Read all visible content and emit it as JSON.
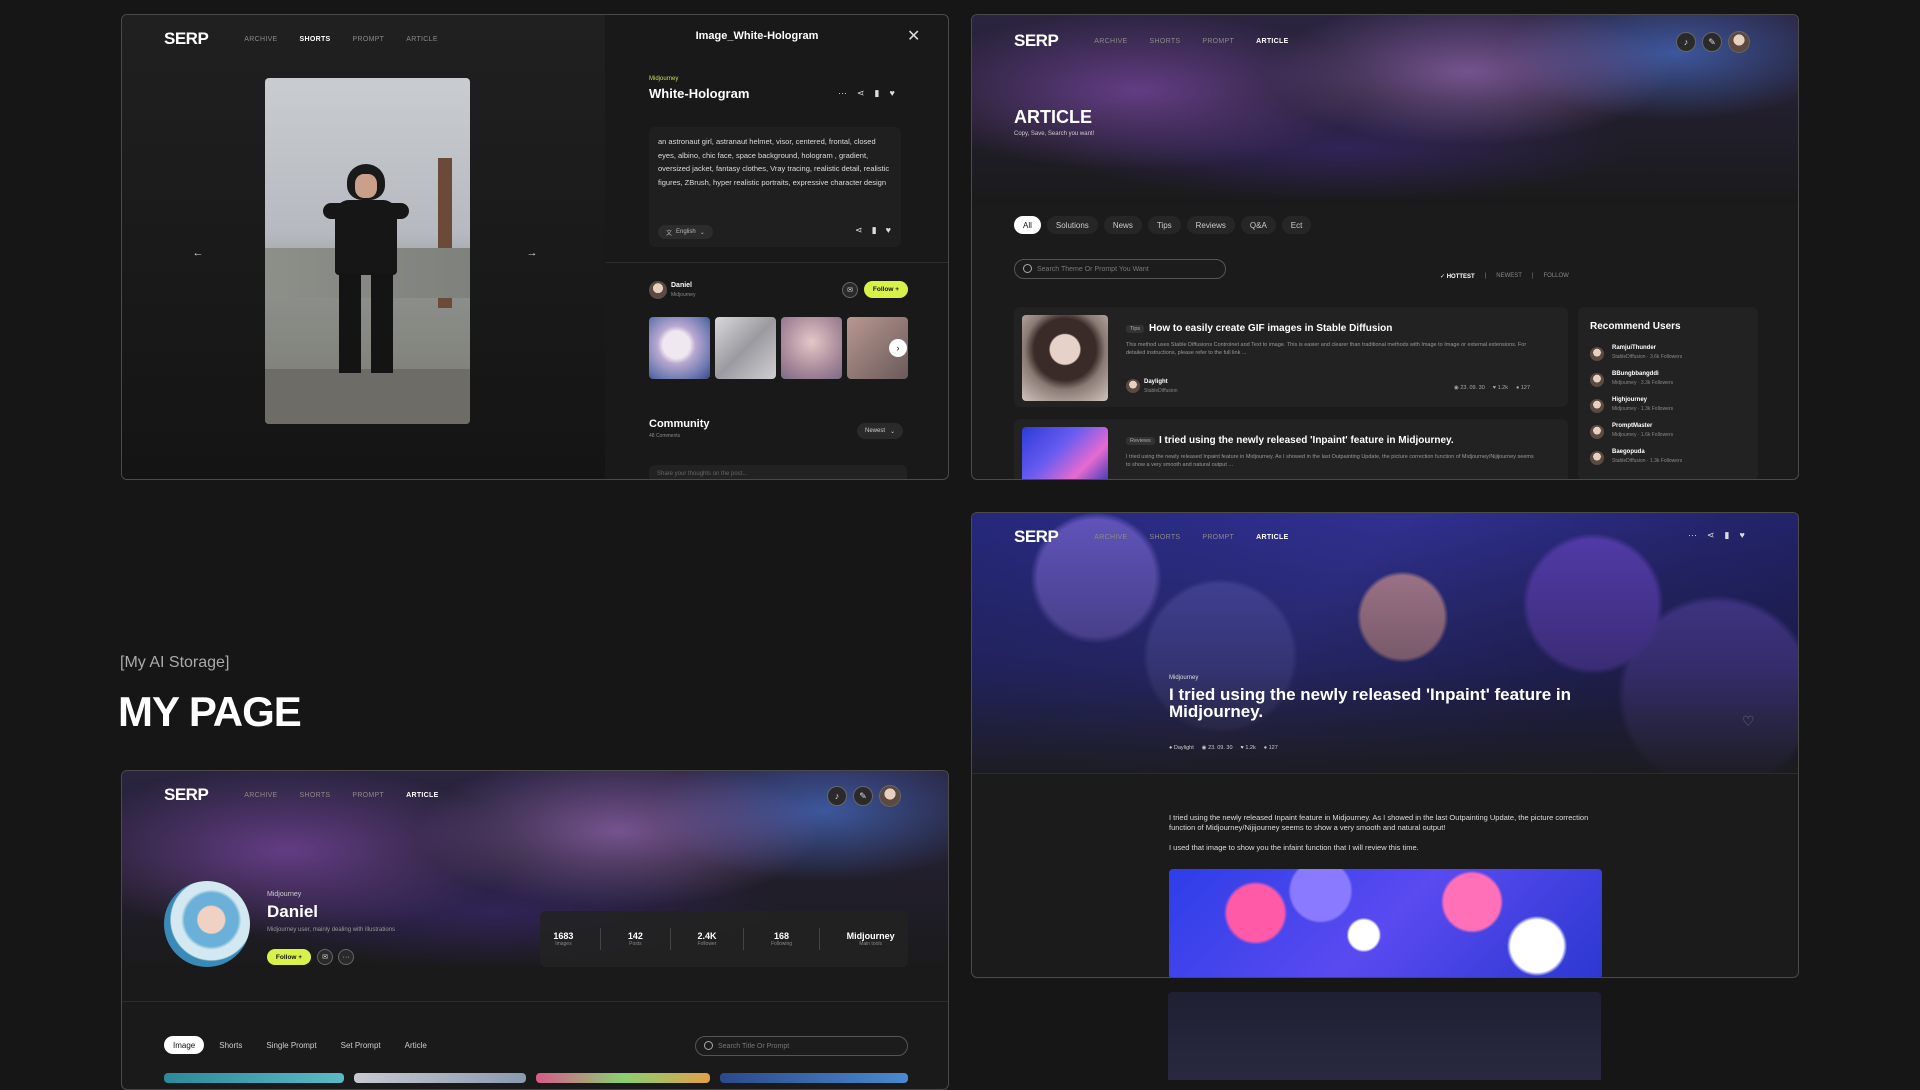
{
  "nav": {
    "logo": "SERP",
    "archive": "ARCHIVE",
    "shorts": "SHORTS",
    "prompt": "PROMPT",
    "article": "ARTICLE"
  },
  "detail": {
    "title": "Image_White-Hologram",
    "source": "Midjourney",
    "name": "White-Hologram",
    "prompt": "an astronaut girl, astranaut helmet, visor, centered, frontal, closed eyes, albino, chic face, space background, hologram , gradient, oversized jacket, fantasy clothes, Vray tracing, realistic detail, realistic figures, ZBrush, hyper realistic portraits, expressive character design",
    "language": "English",
    "author_name": "Daniel",
    "author_sub": "Midjourney",
    "follow": "Follow +",
    "community": "Community",
    "comments": "48 Comments",
    "sort": "Newest",
    "comment_placeholder": "Share your thoughts on the post..."
  },
  "article_list": {
    "heading": "ARTICLE",
    "sub": "Copy, Save, Search you want!",
    "tabs": [
      "All",
      "Solutions",
      "News",
      "Tips",
      "Reviews",
      "Q&A",
      "Ect"
    ],
    "search_placeholder": "Search Theme Or Prompt You Want",
    "sort": [
      "HOTTEST",
      "NEWEST",
      "FOLLOW"
    ],
    "posts": [
      {
        "tag": "Tips",
        "title": "How to easily create GIF images in Stable Diffusion",
        "body": "This method uses Stable Diffusions Controlnet and Text to image. This is easier and clearer than traditional methods with Image to Image or external extensions. For detailed instructions, please refer to the full link ...",
        "author": "Daylight",
        "author_sub": "StableDiffusion",
        "date": "23. 09. 30",
        "likes": "1.2k",
        "comments": "127"
      },
      {
        "tag": "Reviews",
        "title": "I tried using the newly released 'Inpaint' feature in Midjourney.",
        "body": "I tried using the newly released Inpaint feature in Midjourney. As I showed in the last Outpainting Update, the picture correction function of Midjourney/Nijijourney seems to show a very smooth and natural output ..."
      }
    ],
    "recommend_title": "Recommend Users",
    "users": [
      {
        "name": "RamjuiThunder",
        "sub": "StableDiffusion · 3.6k Followers"
      },
      {
        "name": "BBungbbangddi",
        "sub": "Midjourney · 3.3k Followers"
      },
      {
        "name": "Highjourney",
        "sub": "Midjourney · 1.3k Followers"
      },
      {
        "name": "PromptMaster",
        "sub": "Midjourney · 1.6k Followers"
      },
      {
        "name": "Baegopuda",
        "sub": "StableDiffusion · 1.3k Followers"
      }
    ]
  },
  "section": {
    "label": "[My AI Storage]",
    "title": "MY PAGE"
  },
  "mypage": {
    "source": "Midjourney",
    "name": "Daniel",
    "bio": "Midjourney user, mainly dealing with illustrations",
    "follow": "Follow +",
    "stats": [
      {
        "value": "1683",
        "label": "Images"
      },
      {
        "value": "142",
        "label": "Posts"
      },
      {
        "value": "2.4K",
        "label": "Follower"
      },
      {
        "value": "168",
        "label": "Following"
      },
      {
        "value": "Midjourney",
        "label": "Main tools"
      }
    ],
    "tabs": [
      "Image",
      "Shorts",
      "Single Prompt",
      "Set Prompt",
      "Article"
    ],
    "search_placeholder": "Search Title Or Prompt"
  },
  "article_detail": {
    "source": "Midjourney",
    "title": "I tried using the newly released 'Inpaint' feature in Midjourney.",
    "author": "Daylight",
    "date": "23. 09. 30",
    "likes": "1.2k",
    "comments": "127",
    "p1": "I tried using the newly released Inpaint feature in Midjourney. As I showed in the last Outpainting Update, the picture correction function of Midjourney/Nijijourney seems to show a very smooth and natural output!",
    "p2": "I used that image to show you the infaint function that I will review this time."
  },
  "colors": {
    "accent": "#d9f24a",
    "bg": "#161616"
  }
}
